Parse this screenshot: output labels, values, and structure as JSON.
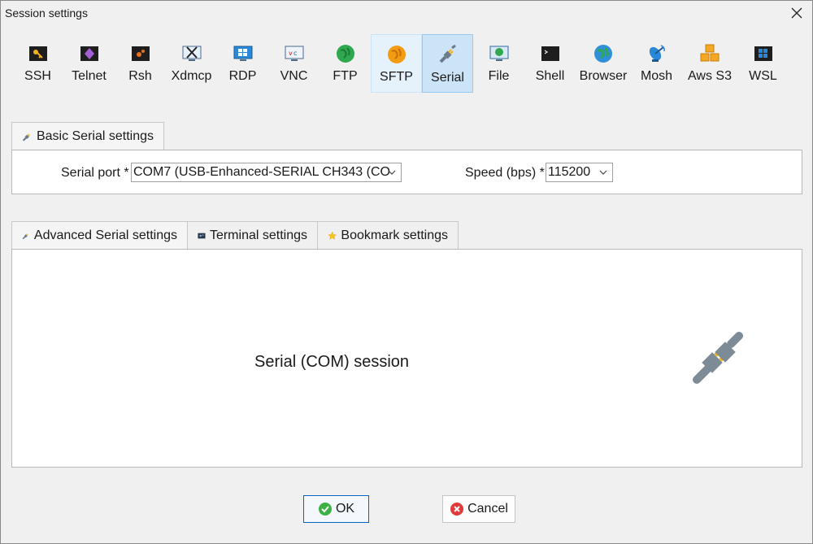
{
  "window": {
    "title": "Session settings"
  },
  "session_types": [
    {
      "label": "SSH",
      "icon": "key-icon"
    },
    {
      "label": "Telnet",
      "icon": "telnet-icon"
    },
    {
      "label": "Rsh",
      "icon": "rsh-icon"
    },
    {
      "label": "Xdmcp",
      "icon": "xdmcp-icon"
    },
    {
      "label": "RDP",
      "icon": "rdp-icon"
    },
    {
      "label": "VNC",
      "icon": "vnc-icon"
    },
    {
      "label": "FTP",
      "icon": "ftp-globe-icon"
    },
    {
      "label": "SFTP",
      "icon": "sftp-globe-icon"
    },
    {
      "label": "Serial",
      "icon": "serial-plug-icon",
      "state": "selected"
    },
    {
      "label": "File",
      "icon": "file-monitor-icon"
    },
    {
      "label": "Shell",
      "icon": "shell-terminal-icon"
    },
    {
      "label": "Browser",
      "icon": "browser-globe-icon"
    },
    {
      "label": "Mosh",
      "icon": "mosh-satellite-icon"
    },
    {
      "label": "Aws S3",
      "icon": "aws-cubes-icon"
    },
    {
      "label": "WSL",
      "icon": "windows-logo-icon"
    }
  ],
  "basic_tab": {
    "label": "Basic Serial settings"
  },
  "serial_port": {
    "label": "Serial port *",
    "value": "COM7  (USB-Enhanced-SERIAL CH343 (CO"
  },
  "speed": {
    "label": "Speed (bps) *",
    "value": "115200"
  },
  "lower_tabs": [
    {
      "label": "Advanced Serial settings",
      "icon": "plug-icon"
    },
    {
      "label": "Terminal settings",
      "icon": "terminal-settings-icon"
    },
    {
      "label": "Bookmark settings",
      "icon": "star-icon"
    }
  ],
  "main": {
    "session_text": "Serial (COM) session"
  },
  "buttons": {
    "ok": "OK",
    "cancel": "Cancel"
  },
  "colors": {
    "selected_bg": "#cce4f7",
    "ok_icon": "#3cb043",
    "cancel_icon": "#e23b3b",
    "accent": "#0067c0"
  }
}
